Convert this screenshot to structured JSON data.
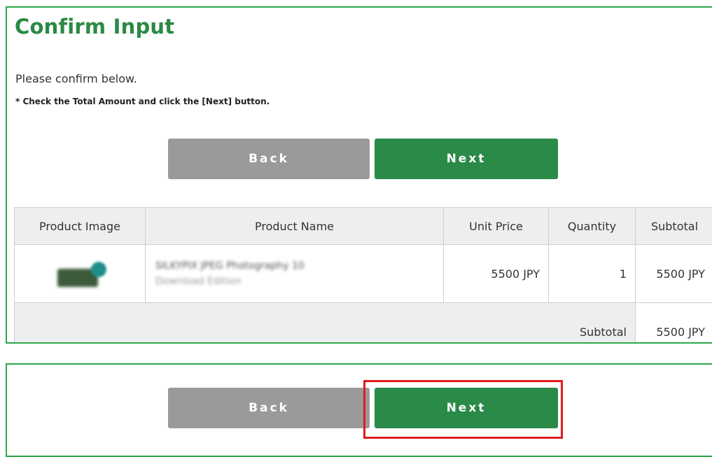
{
  "page": {
    "title": "Confirm Input",
    "intro": "Please confirm below.",
    "note": "* Check the Total Amount and click the [Next] button."
  },
  "buttons": {
    "back": "Back",
    "next": "Next"
  },
  "table": {
    "headers": {
      "image": "Product Image",
      "name": "Product Name",
      "unit_price": "Unit Price",
      "quantity": "Quantity",
      "subtotal": "Subtotal"
    },
    "rows": [
      {
        "name": "SILKYPIX JPEG Photography 10",
        "edition": "Download Edition",
        "unit_price": "5500 JPY",
        "quantity": "1",
        "subtotal": "5500 JPY"
      }
    ],
    "summary": {
      "label": "Subtotal",
      "value": "5500 JPY"
    }
  },
  "colors": {
    "accent": "#2a8a48",
    "border": "#2ea84a",
    "back_button": "#9a9a9a",
    "highlight": "#e01b1b"
  },
  "icons": {
    "product_thumbnail": "product-box-image"
  }
}
